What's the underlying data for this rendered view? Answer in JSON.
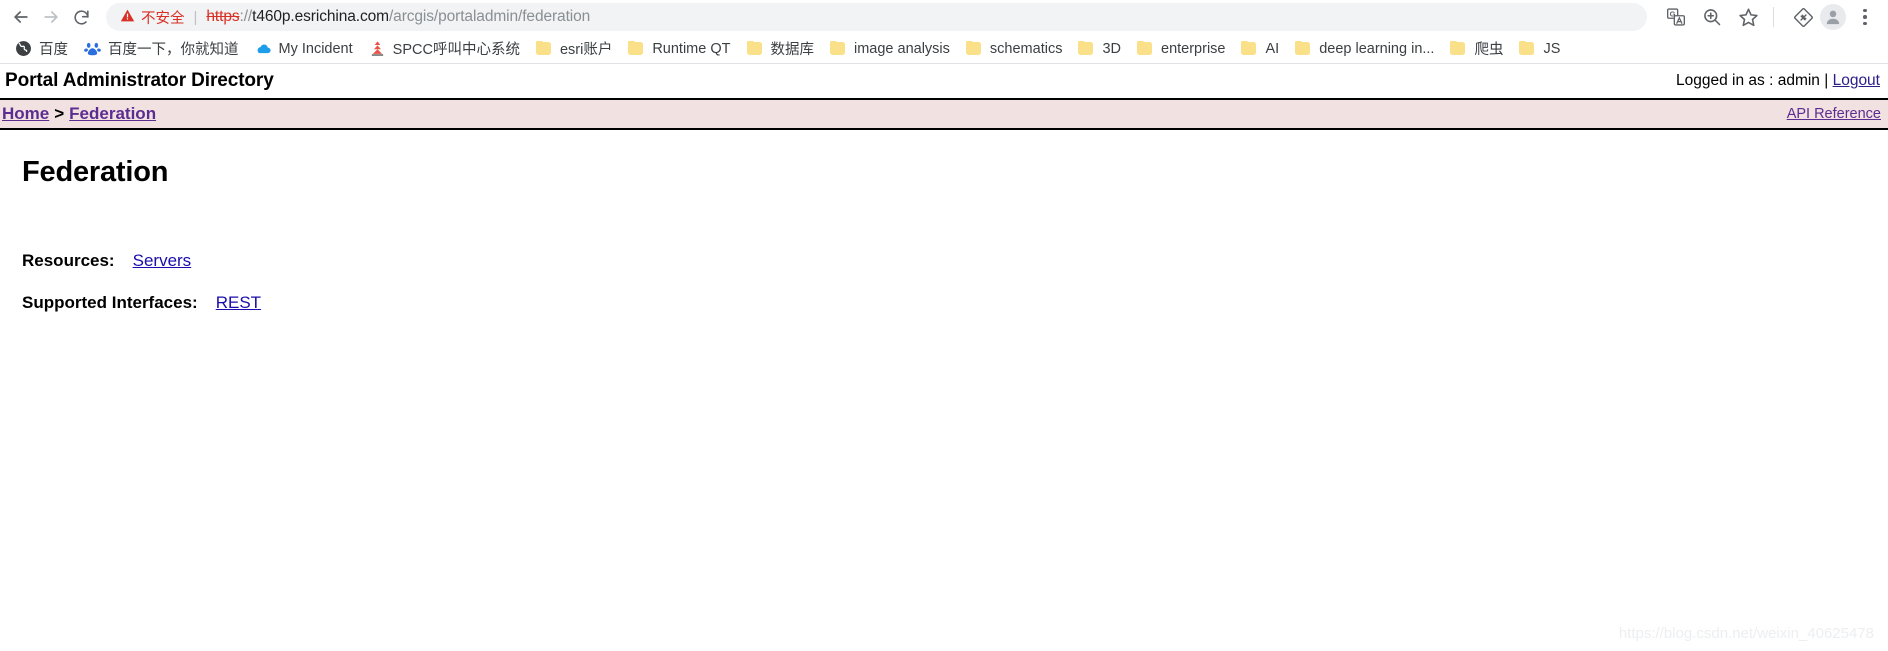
{
  "browser": {
    "nav": {
      "back": "back-arrow",
      "forward": "forward-arrow",
      "reload": "reload-arrow"
    },
    "omnibox": {
      "security_label": "不安全",
      "security_icon": "warning-triangle-icon",
      "separator": "|",
      "url_scheme": "https",
      "url_scheme_suffix": "://",
      "url_host": "t460p.esrichina.com",
      "url_path": "/arcgis/portaladmin/federation",
      "full_url": "https://t460p.esrichina.com/arcgis/portaladmin/federation"
    },
    "actions": [
      {
        "name": "translate-icon",
        "title": "翻译此网页"
      },
      {
        "name": "zoom-in-icon",
        "title": "缩放"
      },
      {
        "name": "bookmark-star-icon",
        "title": "将此标签页加入书签"
      },
      {
        "name": "extension-icon",
        "title": "扩展程序"
      },
      {
        "name": "avatar-icon",
        "title": "个人资料"
      },
      {
        "name": "chrome-menu-icon",
        "title": "自定义及控制"
      }
    ],
    "bookmarks": [
      {
        "label": "百度",
        "icon": "globe-icon"
      },
      {
        "label": "百度一下，你就知道",
        "icon": "baidu-paw-icon"
      },
      {
        "label": "My Incident",
        "icon": "cloud-icon"
      },
      {
        "label": "SPCC呼叫中心系统",
        "icon": "tower-icon"
      },
      {
        "label": "esri账户",
        "icon": "folder-icon"
      },
      {
        "label": "Runtime QT",
        "icon": "folder-icon"
      },
      {
        "label": "数据库",
        "icon": "folder-icon"
      },
      {
        "label": "image analysis",
        "icon": "folder-icon"
      },
      {
        "label": "schematics",
        "icon": "folder-icon"
      },
      {
        "label": "3D",
        "icon": "folder-icon"
      },
      {
        "label": "enterprise",
        "icon": "folder-icon"
      },
      {
        "label": "AI",
        "icon": "folder-icon"
      },
      {
        "label": "deep learning in...",
        "icon": "folder-icon"
      },
      {
        "label": "爬虫",
        "icon": "folder-icon"
      },
      {
        "label": "JS",
        "icon": "folder-icon"
      }
    ]
  },
  "app": {
    "title": "Portal Administrator Directory",
    "login_prefix": "Logged in as : admin |",
    "logout_label": "Logout",
    "breadcrumb": {
      "home_label": "Home",
      "separator": ">",
      "current_label": "Federation"
    },
    "api_reference_label": "API Reference",
    "heading": "Federation",
    "rows": [
      {
        "label": "Resources:",
        "link": "Servers"
      },
      {
        "label": "Supported Interfaces:",
        "link": "REST"
      }
    ]
  },
  "watermark": "https://blog.csdn.net/weixin_40625478",
  "colors": {
    "breadcrumb_bg": "#f2e1e1",
    "link_purple": "#5c2d91",
    "link_blue": "#1a0dab",
    "warning_red": "#d93025",
    "folder_yellow": "#fbe08a"
  }
}
